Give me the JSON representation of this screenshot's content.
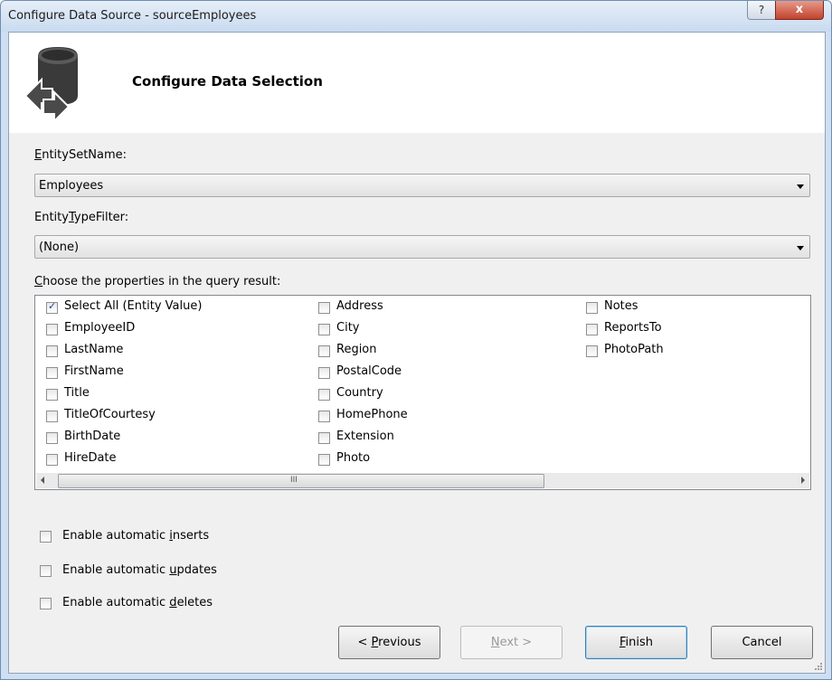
{
  "window": {
    "title": "Configure Data Source - sourceEmployees",
    "help_label": "?",
    "close_label": "x"
  },
  "header": {
    "title": "Configure Data Selection",
    "icon": "data-source-icon"
  },
  "entity_set": {
    "label_prefix": "",
    "label_ul": "E",
    "label_rest": "ntitySetName:",
    "value": "Employees"
  },
  "entity_type": {
    "label_prefix": "Entity",
    "label_ul": "T",
    "label_rest": "ypeFilter:",
    "value": "(None)"
  },
  "properties": {
    "label_prefix": "",
    "label_ul": "C",
    "label_rest": "hoose the properties in the query result:",
    "col1": [
      {
        "label": "Select All (Entity Value)",
        "checked": true
      },
      {
        "label": "EmployeeID",
        "checked": false
      },
      {
        "label": "LastName",
        "checked": false
      },
      {
        "label": "FirstName",
        "checked": false
      },
      {
        "label": "Title",
        "checked": false
      },
      {
        "label": "TitleOfCourtesy",
        "checked": false
      },
      {
        "label": "BirthDate",
        "checked": false
      },
      {
        "label": "HireDate",
        "checked": false
      }
    ],
    "col2": [
      {
        "label": "Address",
        "checked": false
      },
      {
        "label": "City",
        "checked": false
      },
      {
        "label": "Region",
        "checked": false
      },
      {
        "label": "PostalCode",
        "checked": false
      },
      {
        "label": "Country",
        "checked": false
      },
      {
        "label": "HomePhone",
        "checked": false
      },
      {
        "label": "Extension",
        "checked": false
      },
      {
        "label": "Photo",
        "checked": false
      }
    ],
    "col3": [
      {
        "label": "Notes",
        "checked": false
      },
      {
        "label": "ReportsTo",
        "checked": false
      },
      {
        "label": "PhotoPath",
        "checked": false
      }
    ],
    "scroll_grip": "III"
  },
  "options": {
    "inserts": {
      "prefix": "Enable automatic ",
      "ul": "i",
      "rest": "nserts",
      "checked": false
    },
    "updates": {
      "prefix": "Enable automatic ",
      "ul": "u",
      "rest": "pdates",
      "checked": false
    },
    "deletes": {
      "prefix": "Enable automatic ",
      "ul": "d",
      "rest": "eletes",
      "checked": false
    }
  },
  "buttons": {
    "previous": {
      "prefix": "< ",
      "ul": "P",
      "rest": "revious"
    },
    "next": {
      "prefix": "",
      "ul": "N",
      "rest": "ext >"
    },
    "finish": {
      "prefix": "",
      "ul": "F",
      "rest": "inish"
    },
    "cancel": {
      "prefix": "",
      "ul": "",
      "rest": "Cancel"
    }
  }
}
